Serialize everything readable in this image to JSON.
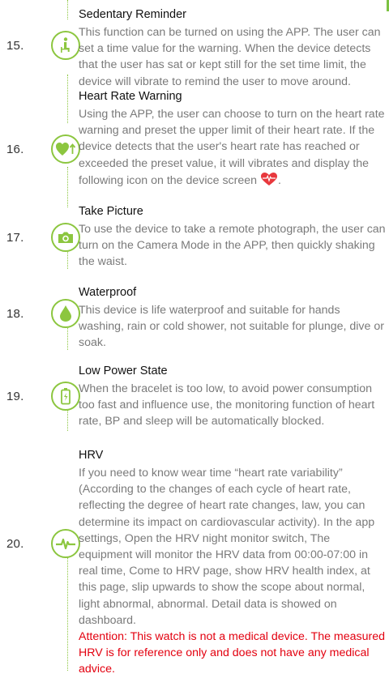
{
  "sections": [
    {
      "number": "15.",
      "icon": "sedentary-person-icon",
      "title": "Sedentary Reminder",
      "body": "This function can be turned on using the APP. The user can set a  time value for the warning. When the device detects that the user has sat or kept still for the set time limit, the device will vibrate to remind the user to move around."
    },
    {
      "number": "16.",
      "icon": "heart-rate-up-icon",
      "title": "Heart Rate Warning",
      "body": "Using the APP, the user can choose to turn on the heart rate warning and preset the upper limit of their heart rate. If the device detects that the user's heart rate has reached or exceeded the preset value, it will vibrates and display the following icon on the device screen",
      "body_suffix": "."
    },
    {
      "number": "17.",
      "icon": "camera-icon",
      "title": "Take Picture",
      "body": "To use the device to take a remote photograph, the user can turn on the Camera Mode in the APP, then quickly shaking the waist."
    },
    {
      "number": "18.",
      "icon": "water-drop-icon",
      "title": "Waterproof",
      "body": "This device is life waterproof and suitable for hands washing, rain or cold shower, not suitable for plunge, dive or soak."
    },
    {
      "number": "19.",
      "icon": "battery-icon",
      "title": "Low Power State",
      "body": "When the bracelet is too low, to avoid power consumption too fast and influence use, the monitoring function of heart rate, BP and sleep will be automatically blocked."
    },
    {
      "number": "20.",
      "icon": "heartbeat-pulse-icon",
      "title": "HRV",
      "body": "If you need to know wear time “heart rate variability” (According to the changes of each cycle of heart rate, reflecting the degree of heart rate changes, law, you can determine its impact on cardiovascular activity). In the app settings, Open the HRV night monitor switch, The equipment will monitor the HRV data from 00:00-07:00 in real time, Come to HRV page, show HRV health index, at this page, slip upwards to show the scope about normal, light abnormal, abnormal. Detail data is showed on dashboard.",
      "attention": "Attention: This watch is not a medical device. The measured HRV is for reference only and does not have any medical advice."
    }
  ],
  "colors": {
    "accent": "#8cc63f",
    "body_text": "#7a7a7a",
    "heading_text": "#111111",
    "attention": "#e3000f",
    "heart_icon": "#e8383d"
  }
}
